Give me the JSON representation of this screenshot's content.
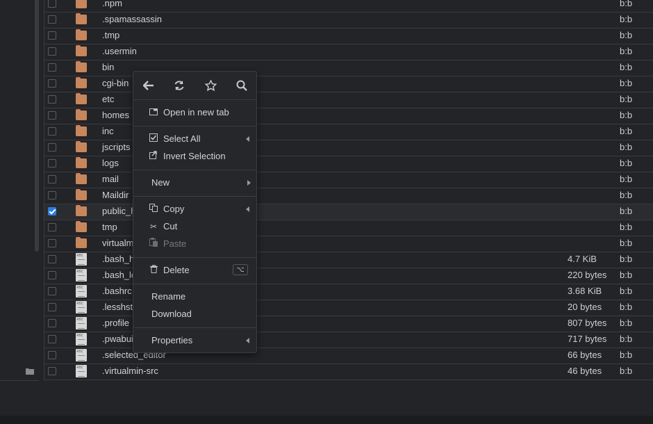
{
  "files": [
    {
      "name": ".npm",
      "type": "folder",
      "size": "",
      "owner": "b:b",
      "checked": false
    },
    {
      "name": ".spamassassin",
      "type": "folder",
      "size": "",
      "owner": "b:b",
      "checked": false
    },
    {
      "name": ".tmp",
      "type": "folder",
      "size": "",
      "owner": "b:b",
      "checked": false
    },
    {
      "name": ".usermin",
      "type": "folder",
      "size": "",
      "owner": "b:b",
      "checked": false
    },
    {
      "name": "bin",
      "type": "folder",
      "size": "",
      "owner": "b:b",
      "checked": false
    },
    {
      "name": "cgi-bin",
      "type": "folder",
      "size": "",
      "owner": "b:b",
      "checked": false
    },
    {
      "name": "etc",
      "type": "folder",
      "size": "",
      "owner": "b:b",
      "checked": false
    },
    {
      "name": "homes",
      "type": "folder",
      "size": "",
      "owner": "b:b",
      "checked": false
    },
    {
      "name": "inc",
      "type": "folder",
      "size": "",
      "owner": "b:b",
      "checked": false
    },
    {
      "name": "jscripts",
      "type": "folder",
      "size": "",
      "owner": "b:b",
      "checked": false
    },
    {
      "name": "logs",
      "type": "folder",
      "size": "",
      "owner": "b:b",
      "checked": false
    },
    {
      "name": "mail",
      "type": "folder",
      "size": "",
      "owner": "b:b",
      "checked": false
    },
    {
      "name": "Maildir",
      "type": "folder",
      "size": "",
      "owner": "b:b",
      "checked": false
    },
    {
      "name": "public_h",
      "type": "folder",
      "size": "",
      "owner": "b:b",
      "checked": true
    },
    {
      "name": "tmp",
      "type": "folder",
      "size": "",
      "owner": "b:b",
      "checked": false
    },
    {
      "name": "virtualm",
      "type": "folder",
      "size": "",
      "owner": "b:b",
      "checked": false
    },
    {
      "name": ".bash_h",
      "type": "text",
      "size": "4.7 KiB",
      "owner": "b:b",
      "checked": false
    },
    {
      "name": ".bash_lo",
      "type": "text",
      "size": "220 bytes",
      "owner": "b:b",
      "checked": false
    },
    {
      "name": ".bashrc",
      "type": "text",
      "size": "3.68 KiB",
      "owner": "b:b",
      "checked": false
    },
    {
      "name": ".lesshst",
      "type": "text",
      "size": "20 bytes",
      "owner": "b:b",
      "checked": false
    },
    {
      "name": ".profile",
      "type": "text",
      "size": "807 bytes",
      "owner": "b:b",
      "checked": false
    },
    {
      "name": ".pwabui",
      "type": "text",
      "size": "717 bytes",
      "owner": "b:b",
      "checked": false
    },
    {
      "name": ".selected_editor",
      "type": "text",
      "size": "66 bytes",
      "owner": "b:b",
      "checked": false
    },
    {
      "name": ".virtualmin-src",
      "type": "text",
      "size": "46 bytes",
      "owner": "b:b",
      "checked": false
    }
  ],
  "context_menu": {
    "toolbar": [
      {
        "icon": "arrow-left-icon",
        "glyph": "🡐"
      },
      {
        "icon": "refresh-icon",
        "glyph": "⟳"
      },
      {
        "icon": "star-icon",
        "glyph": "☆"
      },
      {
        "icon": "search-icon",
        "glyph": "⚲"
      }
    ],
    "open_new_tab": "Open in new tab",
    "select_all": "Select All",
    "invert_selection": "Invert Selection",
    "new": "New",
    "copy": "Copy",
    "cut": "Cut",
    "paste": "Paste",
    "delete": "Delete",
    "delete_shortcut": "⌥",
    "rename": "Rename",
    "download": "Download",
    "properties": "Properties"
  },
  "colors": {
    "background": "#232427",
    "folder": "#c8875a",
    "checkbox_checked": "#2a7de1",
    "menu_background": "#26272b"
  }
}
